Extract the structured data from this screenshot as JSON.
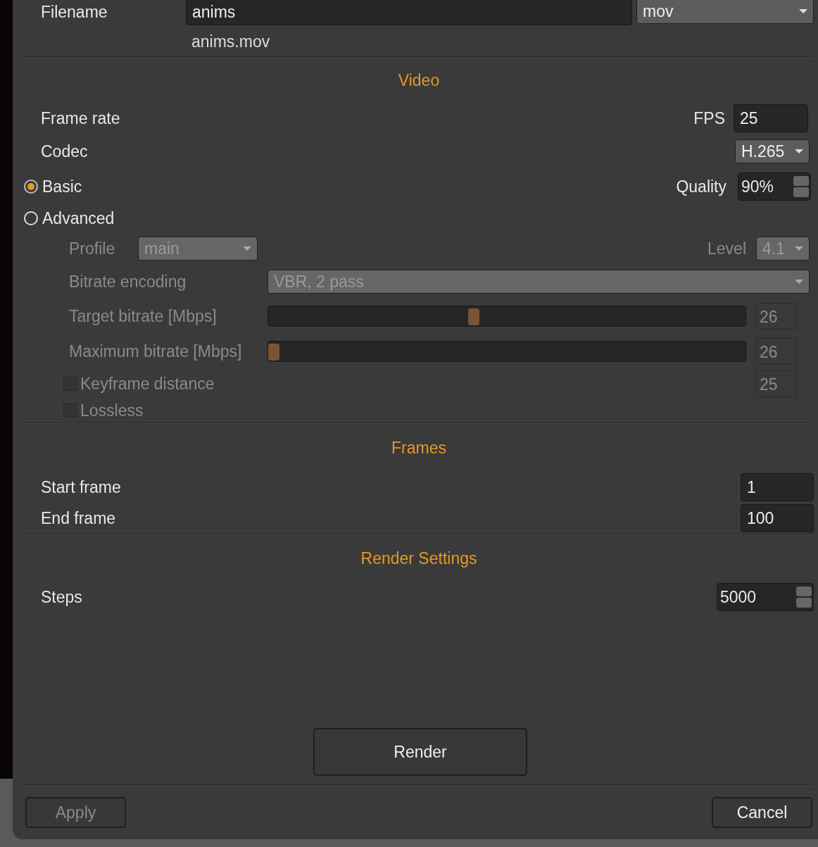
{
  "filename": {
    "label": "Filename",
    "value": "anims",
    "format": "mov",
    "resolved": "anims.mov"
  },
  "video": {
    "title": "Video",
    "frame_rate": {
      "label": "Frame rate",
      "unit": "FPS",
      "value": "25"
    },
    "codec": {
      "label": "Codec",
      "value": "H.265"
    },
    "modes": [
      {
        "label": "Basic",
        "selected": true
      },
      {
        "label": "Advanced",
        "selected": false
      }
    ],
    "quality": {
      "label": "Quality",
      "value": "90%"
    },
    "profile": {
      "label": "Profile",
      "value": "main",
      "disabled": true
    },
    "level": {
      "label": "Level",
      "value": "4.1",
      "disabled": true
    },
    "bitrate_encoding": {
      "label": "Bitrate encoding",
      "value": "VBR, 2 pass",
      "disabled": true
    },
    "sliders": [
      {
        "label": "Target bitrate [Mbps]",
        "level": 0.43,
        "reading": "26",
        "disabled": true
      },
      {
        "label": "Maximum bitrate [Mbps]",
        "level": 0.0,
        "reading": "26",
        "disabled": true
      }
    ],
    "checks": [
      {
        "label": "Keyframe distance",
        "checked": false,
        "value": "25",
        "disabled": true
      },
      {
        "label": "Lossless",
        "checked": false,
        "disabled": true
      }
    ]
  },
  "frames": {
    "title": "Frames",
    "start": {
      "label": "Start frame",
      "value": "1"
    },
    "end": {
      "label": "End frame",
      "value": "100"
    }
  },
  "render_settings": {
    "title": "Render Settings",
    "steps": {
      "label": "Steps",
      "value": "5000"
    }
  },
  "render_button": "Render",
  "buttons": [
    {
      "label": "Apply",
      "disabled": true
    },
    {
      "label": "Cancel",
      "disabled": false
    }
  ]
}
